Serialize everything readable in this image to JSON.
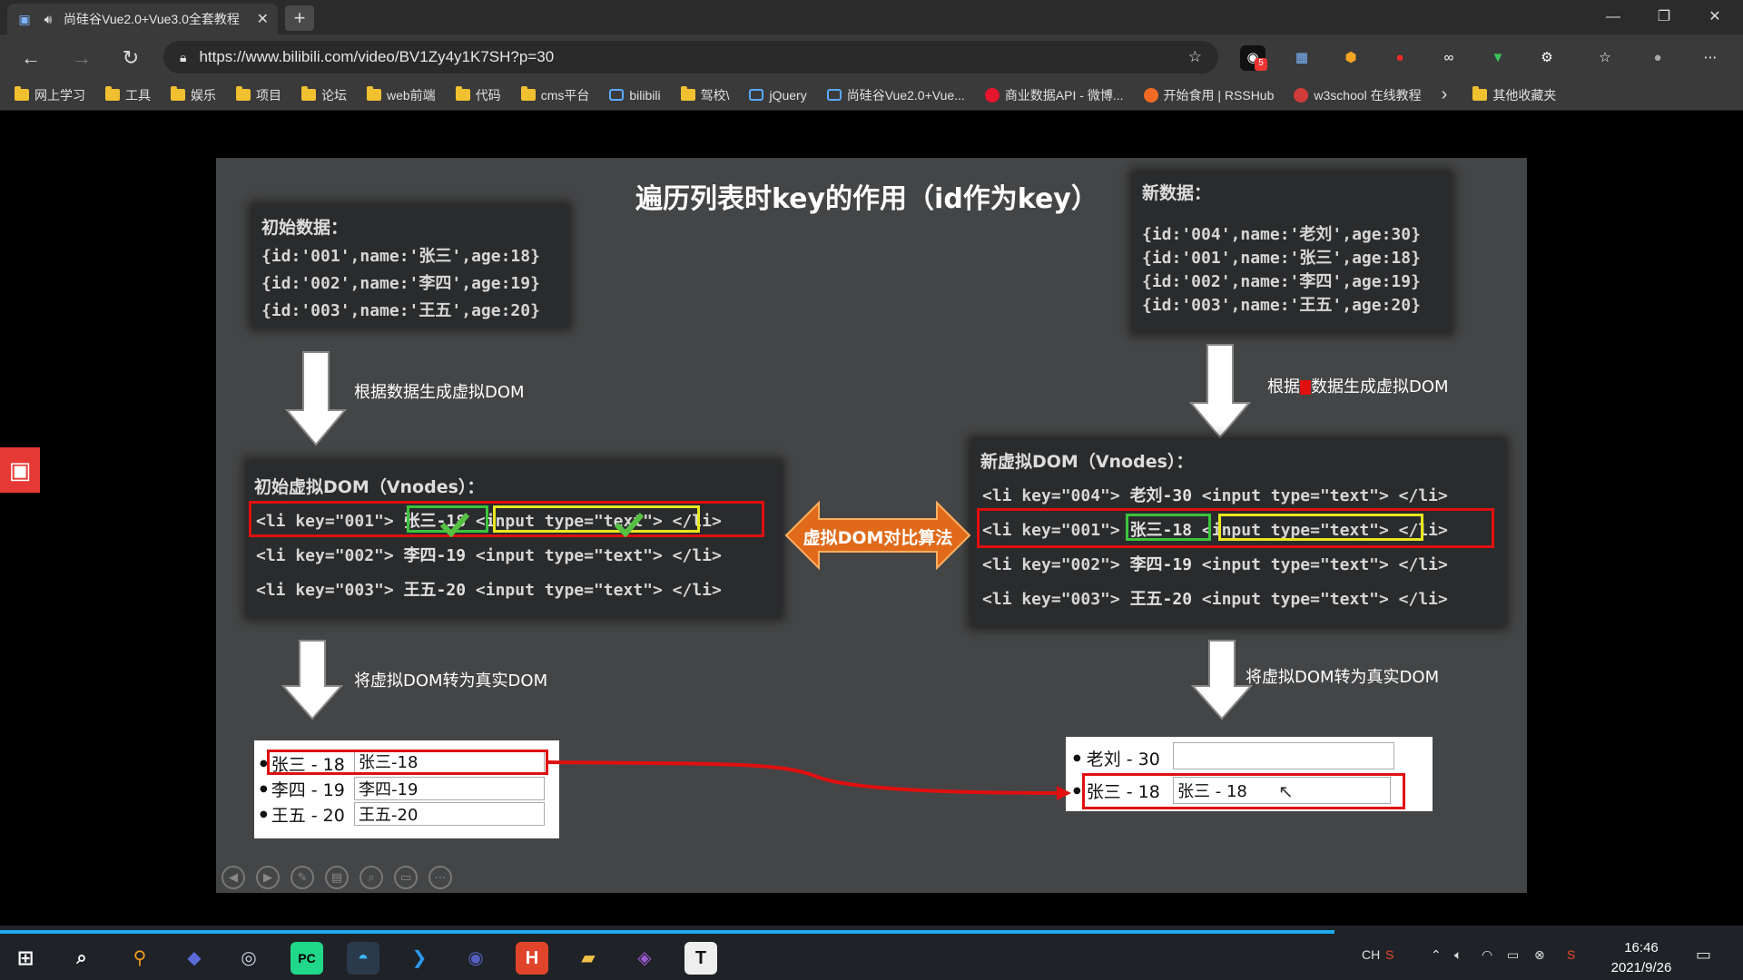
{
  "browser": {
    "tab_title": "尚硅谷Vue2.0+Vue3.0全套教程",
    "close_glyph": "✕",
    "new_tab_glyph": "+",
    "url": "https://www.bilibili.com/video/BV1Zy4y1K7SH?p=30",
    "bookmarks": [
      "网上学习",
      "工具",
      "娱乐",
      "项目",
      "论坛",
      "web前端",
      "代码",
      "cms平台",
      "bilibili",
      "驾校\\",
      "jQuery",
      "尚硅谷Vue2.0+Vue...",
      "商业数据API - 微博...",
      "开始食用 | RSSHub",
      "w3school 在线教程"
    ],
    "bookmarks_more": "›",
    "other_bookmarks": "其他收藏夹",
    "ext_badge": "5"
  },
  "slide": {
    "title": "遍历列表时key的作用（id作为key）",
    "initial_data": {
      "heading": "初始数据：",
      "lines": [
        "{id:'001',name:'张三',age:18}",
        "{id:'002',name:'李四',age:19}",
        "{id:'003',name:'王五',age:20}"
      ]
    },
    "new_data": {
      "heading": "新数据：",
      "lines": [
        "{id:'004',name:'老刘',age:30}",
        "{id:'001',name:'张三',age:18}",
        "{id:'002',name:'李四',age:19}",
        "{id:'003',name:'王五',age:20}"
      ]
    },
    "caption_left_generate": "根据数据生成虚拟DOM",
    "caption_right_generate_a": "根据",
    "caption_right_generate_b": "数据生成虚拟DOM",
    "caption_left_convert": "将虚拟DOM转为真实DOM",
    "caption_right_convert": "将虚拟DOM转为真实DOM",
    "initial_vdom": {
      "heading": "初始虚拟DOM（Vnodes）：",
      "rows": [
        {
          "open": "<li key=\"001\">",
          "text": "张三-18",
          "input": "<input type=\"text\">",
          "close": "</li>"
        },
        {
          "open": "<li key=\"002\">",
          "text": "李四-19",
          "input": "<input type=\"text\">",
          "close": "</li>"
        },
        {
          "open": "<li key=\"003\">",
          "text": "王五-20",
          "input": "<input type=\"text\">",
          "close": "</li>"
        }
      ]
    },
    "new_vdom": {
      "heading": "新虚拟DOM（Vnodes）：",
      "rows": [
        {
          "open": "<li key=\"004\">",
          "text": "老刘-30",
          "input": "<input type=\"text\">",
          "close": "</li>"
        },
        {
          "open": "<li key=\"001\">",
          "text": "张三-18",
          "input": "<input type=\"text\">",
          "close": "</li>"
        },
        {
          "open": "<li key=\"002\">",
          "text": "李四-19",
          "input": "<input type=\"text\">",
          "close": "</li>"
        },
        {
          "open": "<li key=\"003\">",
          "text": "王五-20",
          "input": "<input type=\"text\">",
          "close": "</li>"
        }
      ]
    },
    "diff_label": "虚拟DOM对比算法",
    "real_dom_left": [
      {
        "label": "张三 - 18",
        "value": "张三-18"
      },
      {
        "label": "李四 - 19",
        "value": "李四-19"
      },
      {
        "label": "王五 - 20",
        "value": "王五-20"
      }
    ],
    "real_dom_right": [
      {
        "label": "老刘 - 30",
        "value": ""
      },
      {
        "label": "张三 - 18",
        "value": "张三 - 18"
      }
    ],
    "bullet": "●"
  },
  "taskbar": {
    "ime": "CH",
    "time": "16:46",
    "date": "2021/9/26"
  },
  "colors": {
    "highlight_red": "#e01010",
    "highlight_green": "#3cc43c",
    "highlight_yellow": "#e8e820",
    "diff_arrow": "#e06a1a",
    "progress": "#1eaaf1"
  }
}
